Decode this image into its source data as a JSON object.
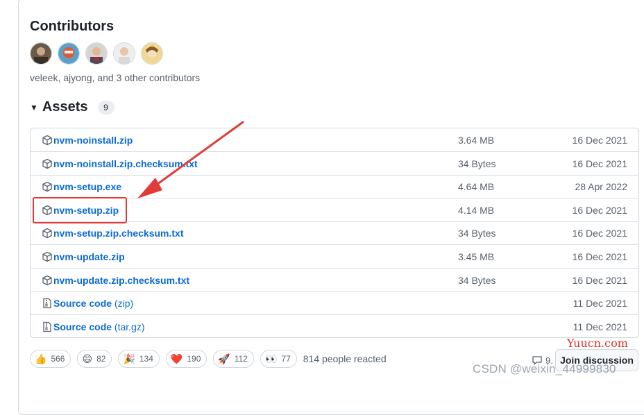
{
  "contributors": {
    "title": "Contributors",
    "avatars": [
      {
        "name": "veleek",
        "color": "#5a4a3a"
      },
      {
        "name": "ajyong",
        "color": "#c9482c"
      },
      {
        "name": "contributor-3",
        "color": "#b0a8a0"
      },
      {
        "name": "contributor-4",
        "color": "#e8e8e8"
      },
      {
        "name": "contributor-5",
        "color": "#d8b060"
      }
    ],
    "summary": "veleek, ajyong, and 3 other contributors"
  },
  "assets": {
    "title": "Assets",
    "count": "9",
    "rows": [
      {
        "name": "nvm-noinstall.zip",
        "format": "",
        "size": "3.64 MB",
        "date": "16 Dec 2021",
        "icon": "package-icon"
      },
      {
        "name": "nvm-noinstall.zip.checksum.txt",
        "format": "",
        "size": "34 Bytes",
        "date": "16 Dec 2021",
        "icon": "package-icon"
      },
      {
        "name": "nvm-setup.exe",
        "format": "",
        "size": "4.64 MB",
        "date": "28 Apr 2022",
        "icon": "package-icon"
      },
      {
        "name": "nvm-setup.zip",
        "format": "",
        "size": "4.14 MB",
        "date": "16 Dec 2021",
        "icon": "package-icon"
      },
      {
        "name": "nvm-setup.zip.checksum.txt",
        "format": "",
        "size": "34 Bytes",
        "date": "16 Dec 2021",
        "icon": "package-icon"
      },
      {
        "name": "nvm-update.zip",
        "format": "",
        "size": "3.45 MB",
        "date": "16 Dec 2021",
        "icon": "package-icon"
      },
      {
        "name": "nvm-update.zip.checksum.txt",
        "format": "",
        "size": "34 Bytes",
        "date": "16 Dec 2021",
        "icon": "package-icon"
      },
      {
        "name": "Source code",
        "format": "(zip)",
        "size": "",
        "date": "11 Dec 2021",
        "icon": "file-zip-icon"
      },
      {
        "name": "Source code",
        "format": "(tar.gz)",
        "size": "",
        "date": "11 Dec 2021",
        "icon": "file-zip-icon"
      }
    ]
  },
  "reactions": {
    "items": [
      {
        "emoji": "👍",
        "count": "566",
        "icon": "thumbs-up-icon"
      },
      {
        "emoji": "😄",
        "count": "82",
        "icon": "smile-icon"
      },
      {
        "emoji": "🎉",
        "count": "134",
        "icon": "tada-icon"
      },
      {
        "emoji": "❤️",
        "count": "190",
        "icon": "heart-icon"
      },
      {
        "emoji": "🚀",
        "count": "112",
        "icon": "rocket-icon"
      },
      {
        "emoji": "👀",
        "count": "77",
        "icon": "eyes-icon"
      }
    ],
    "summary": "814 people reacted"
  },
  "discussion": {
    "comment_count": "9.",
    "join_label": "Join discussion"
  },
  "watermarks": {
    "yuucn": "Yuucn.com",
    "csdn": "CSDN @weixin_44999830"
  },
  "colors": {
    "link": "#0969da",
    "annotation_red": "#e23a36",
    "border": "#d0d7de"
  }
}
